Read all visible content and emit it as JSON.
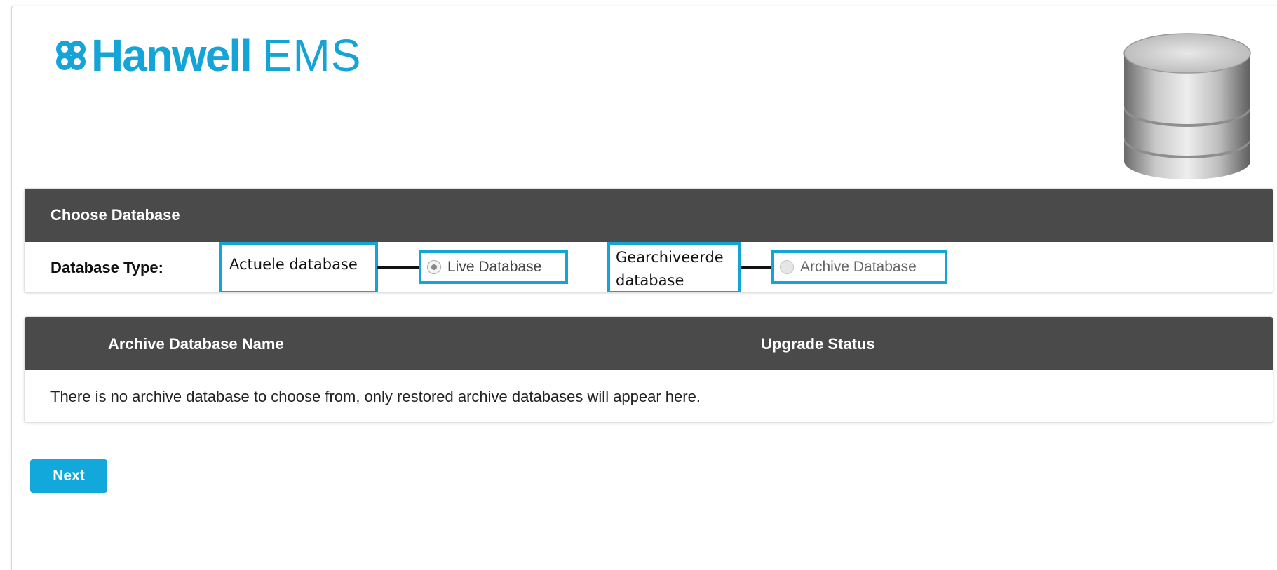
{
  "brand": {
    "name": "Hanwell",
    "product": "EMS",
    "logo_icon": "hanwell-trefoil-icon",
    "accent_color": "#14a4d8"
  },
  "database_icon": "database-cylinder-icon",
  "choose_database": {
    "title": "Choose Database",
    "type_label": "Database Type:",
    "options": [
      {
        "callout": "Actuele database",
        "label": "Live Database",
        "selected": true
      },
      {
        "callout": "Gearchiveerde database",
        "label": "Archive Database",
        "selected": false
      }
    ]
  },
  "archive_table": {
    "columns": [
      "Archive Database Name",
      "Upgrade Status"
    ],
    "empty_message": "There is no archive database to choose from, only restored archive databases will appear here."
  },
  "actions": {
    "next_label": "Next"
  },
  "colors": {
    "header_bg": "#4a4a4a",
    "button_bg": "#12a8dc",
    "callout_border": "#14a4d8"
  }
}
